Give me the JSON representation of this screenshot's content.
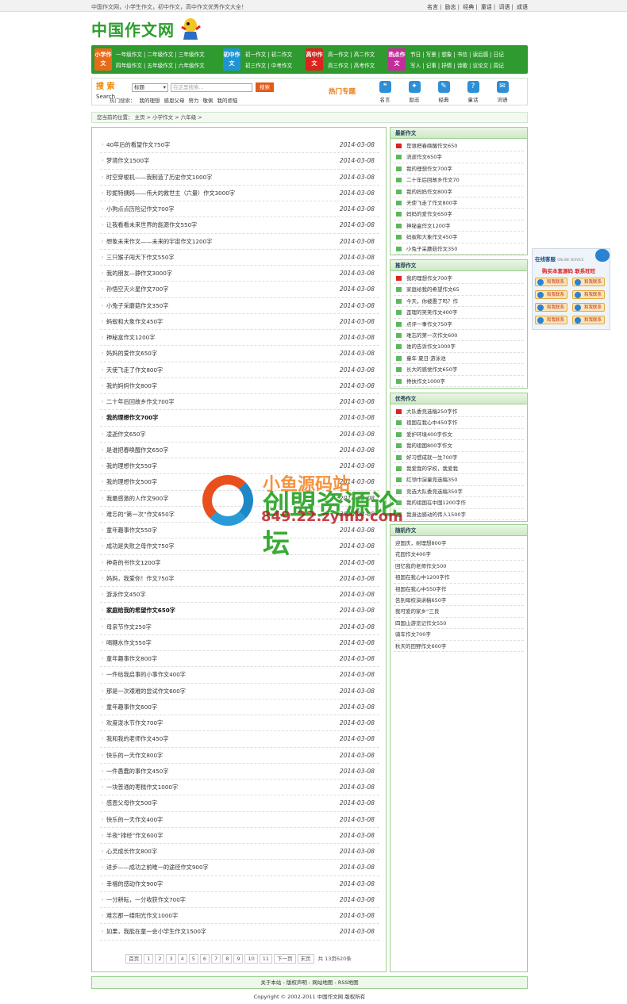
{
  "topbar": {
    "slogan": "中国作文网，小学生作文，初中作文，高中作文优秀作文大全！",
    "links": [
      "名言",
      "励志",
      "经典",
      "童话",
      "词语",
      "成语"
    ]
  },
  "logo": {
    "text": "中国作文网"
  },
  "nav": {
    "blocks": [
      {
        "label": "小学作文",
        "color": "#e86b1a",
        "rows": [
          [
            "一年级作文",
            "二年级作文",
            "三年级作文"
          ],
          [
            "四年级作文",
            "五年级作文",
            "六年级作文"
          ]
        ]
      },
      {
        "label": "初中作文",
        "color": "#1f94d4",
        "rows": [
          [
            "初一作文",
            "初二作文"
          ],
          [
            "初三作文",
            "中考作文"
          ]
        ]
      },
      {
        "label": "高中作文",
        "color": "#d9251d",
        "rows": [
          [
            "高一作文",
            "高二作文"
          ],
          [
            "高三作文",
            "高考作文"
          ]
        ]
      },
      {
        "label": "热点作文",
        "color": "#c42d9c",
        "rows": [
          [
            "节日",
            "写景",
            "想象",
            "书信",
            "读后感",
            "日记"
          ],
          [
            "写人",
            "记事",
            "抒情",
            "诗歌",
            "议论文",
            "周记"
          ]
        ]
      }
    ]
  },
  "search": {
    "title_cn": "搜 索",
    "title_en": "Search",
    "select_value": "标题",
    "placeholder": "在这里搜索...",
    "button": "搜索",
    "hot_label": "热门搜索：",
    "hot_items": [
      "我的理想",
      "感恩父母",
      "努力",
      "敬佩",
      "我的烦恼"
    ],
    "topics_label": "热门专题",
    "topic_icons": [
      {
        "label": "名言",
        "icon": "quote-icon"
      },
      {
        "label": "励志",
        "icon": "star-icon"
      },
      {
        "label": "经典",
        "icon": "book-icon"
      },
      {
        "label": "童话",
        "icon": "question-icon"
      },
      {
        "label": "词语",
        "icon": "chat-icon"
      }
    ]
  },
  "breadcrumb": "您当前的位置： 主页 > 小学作文 > 六年级 >",
  "articles": [
    {
      "title": "40年后的看望作文750字",
      "date": "2014-03-08"
    },
    {
      "title": "梦境作文1500字",
      "date": "2014-03-08"
    },
    {
      "title": "时空穿梭机——我制造了历史作文1000字",
      "date": "2014-03-08"
    },
    {
      "title": "珍妮特姨妈——伟大的救世主（六量）作文3000字",
      "date": "2014-03-08"
    },
    {
      "title": "小狗点点历险记作文700字",
      "date": "2014-03-08"
    },
    {
      "title": "让我看看未来世界的能源作文550字",
      "date": "2014-03-08"
    },
    {
      "title": "想象未来作文——未来的宇宙作文1200字",
      "date": "2014-03-08"
    },
    {
      "title": "三只猴子闯天下作文550字",
      "date": "2014-03-08"
    },
    {
      "title": "我的朋友—静作文3000字",
      "date": "2014-03-08"
    },
    {
      "title": "孙悟空灭火星作文700字",
      "date": "2014-03-08"
    },
    {
      "title": "小兔子采蘑菇作文350字",
      "date": "2014-03-08"
    },
    {
      "title": "蚂蚁和大象作文450字",
      "date": "2014-03-08"
    },
    {
      "title": "神秘盒作文1200字",
      "date": "2014-03-08"
    },
    {
      "title": "妈妈的爱作文650字",
      "date": "2014-03-08"
    },
    {
      "title": "天使飞走了作文800字",
      "date": "2014-03-08"
    },
    {
      "title": "我的妈妈作文800字",
      "date": "2014-03-08"
    },
    {
      "title": "二十年后回故乡作文700字",
      "date": "2014-03-08"
    },
    {
      "title": "我的理想作文700字",
      "date": "2014-03-08",
      "bold": true
    },
    {
      "title": "凌逝作文650字",
      "date": "2014-03-08"
    },
    {
      "title": "是谁把春唤醒作文650字",
      "date": "2014-03-08"
    },
    {
      "title": "我的理想作文550字",
      "date": "2014-03-08"
    },
    {
      "title": "我的理想作文500字",
      "date": "2014-03-08"
    },
    {
      "title": "我最感激的人作文900字",
      "date": "2014-03-08"
    },
    {
      "title": "难忘的“第一次”作文650字",
      "date": "2014-03-08"
    },
    {
      "title": "童年趣事作文550字",
      "date": "2014-03-08"
    },
    {
      "title": "成功是失败之母作文750字",
      "date": "2014-03-08"
    },
    {
      "title": "神奇的书作文1200字",
      "date": "2014-03-08"
    },
    {
      "title": "妈妈，我爱你！作文750字",
      "date": "2014-03-08"
    },
    {
      "title": "游泳作文450字",
      "date": "2014-03-08"
    },
    {
      "title": "家庭给我的希望作文650字",
      "date": "2014-03-08",
      "bold": true
    },
    {
      "title": "母亲节作文250字",
      "date": "2014-03-08"
    },
    {
      "title": "喝糖水作文550字",
      "date": "2014-03-08"
    },
    {
      "title": "童年趣事作文800字",
      "date": "2014-03-08"
    },
    {
      "title": "一件给我启事的小事作文400字",
      "date": "2014-03-08"
    },
    {
      "title": "那是一次艰难的尝试作文600字",
      "date": "2014-03-08"
    },
    {
      "title": "童年趣事作文600字",
      "date": "2014-03-08"
    },
    {
      "title": "欢度泼水节作文700字",
      "date": "2014-03-08"
    },
    {
      "title": "我和我的老师作文450字",
      "date": "2014-03-08"
    },
    {
      "title": "快乐的一天作文800字",
      "date": "2014-03-08"
    },
    {
      "title": "一件愚蠢的事作文450字",
      "date": "2014-03-08"
    },
    {
      "title": "一块普通的枣糕作文1000字",
      "date": "2014-03-08"
    },
    {
      "title": "感恩父母作文500字",
      "date": "2014-03-08"
    },
    {
      "title": "快乐的一天作文400字",
      "date": "2014-03-08"
    },
    {
      "title": "半夜“排经”作文600字",
      "date": "2014-03-08"
    },
    {
      "title": "心灵成长作文800字",
      "date": "2014-03-08"
    },
    {
      "title": "进步——成功之前唯一的途径作文900字",
      "date": "2014-03-08"
    },
    {
      "title": "幸福的感动作文900字",
      "date": "2014-03-08"
    },
    {
      "title": "一分耕耘，一分收获作文700字",
      "date": "2014-03-08"
    },
    {
      "title": "难忘那一缕阳光作文1000字",
      "date": "2014-03-08"
    },
    {
      "title": "如果，我能在童一会小学生作文1500字",
      "date": "2014-03-08"
    }
  ],
  "pager": {
    "first": "首页",
    "pages": [
      "1",
      "2",
      "3",
      "4",
      "5",
      "6",
      "7",
      "8",
      "9",
      "10",
      "11"
    ],
    "next": "下一页",
    "last": "末页",
    "total": "共 13页620条"
  },
  "sidebar": {
    "latest": {
      "title": "最新作文",
      "items": [
        "是谁把春唤醒作文650",
        "流逝作文650字",
        "我的理想作文700字",
        "二十年后回故乡作文70",
        "我的妈妈作文800字",
        "天使飞走了作文800字",
        "妈妈的爱作文650字",
        "神秘盒作文1200字",
        "蚂蚁和大象作文450字",
        "小兔子采蘑菇作文350"
      ]
    },
    "recommended": {
      "title": "推荐作文",
      "items": [
        "我的理想作文700字",
        "家庭给我的希望作文65",
        "今天，你被愚了吗？作",
        "歪理的笑笑作文400字",
        "点评一事作文750字",
        "难忘的第一次作文600",
        "谁的告诉作文1000字",
        "童年·夏日·游泳池",
        "长大的感觉作文650字",
        "搀扶作文1000字"
      ]
    },
    "excellent": {
      "title": "优秀作文",
      "items": [
        "大队委竞选稿250字作",
        "祖国在我心中450字作",
        "爱护环境400字作文",
        "我的祖国800字作文",
        "好习惯成就一生700字",
        "我爱我的学校，我爱我",
        "红领巾演童竞选稿350",
        "竞选大队委竞选稿350字",
        "我的祖国在中国1200字作",
        "我身边感动的伟人1500字"
      ]
    },
    "random": {
      "title": "随机作文",
      "items": [
        "迎国庆，树理想800字",
        "花园作文400字",
        "回忆我的老师作文500",
        "祖国在我心中1200字作",
        "祖国在我心中550字作",
        "告别母校演讲稿650字",
        "我可爱的家乡“三良",
        "四国山游览记作文550",
        "骑车作文700字",
        "秋天的田野作文600字"
      ]
    }
  },
  "kefu": {
    "title": "在线客服",
    "subtitle": "ONLINE SERVICE",
    "notice": "购买本套源码 联系旺旺",
    "buttons": [
      "和我联系",
      "和我联系",
      "和我联系",
      "和我联系",
      "和我联系",
      "和我联系",
      "和我联系",
      "和我联系"
    ]
  },
  "watermark": {
    "line1": "小鱼源码站",
    "line2": "创盟资源论坛",
    "line3": "849.22.zymb.com"
  },
  "footer": {
    "links": "关于本站 - 版权声明 - 网站地图 - RSS地图",
    "copyright": "Copyright © 2002-2011 中国作文网 版权所有"
  },
  "colors": {
    "brand_green": "#2f9a2f",
    "accent_orange": "#f08a00",
    "date_color": "#444444"
  }
}
